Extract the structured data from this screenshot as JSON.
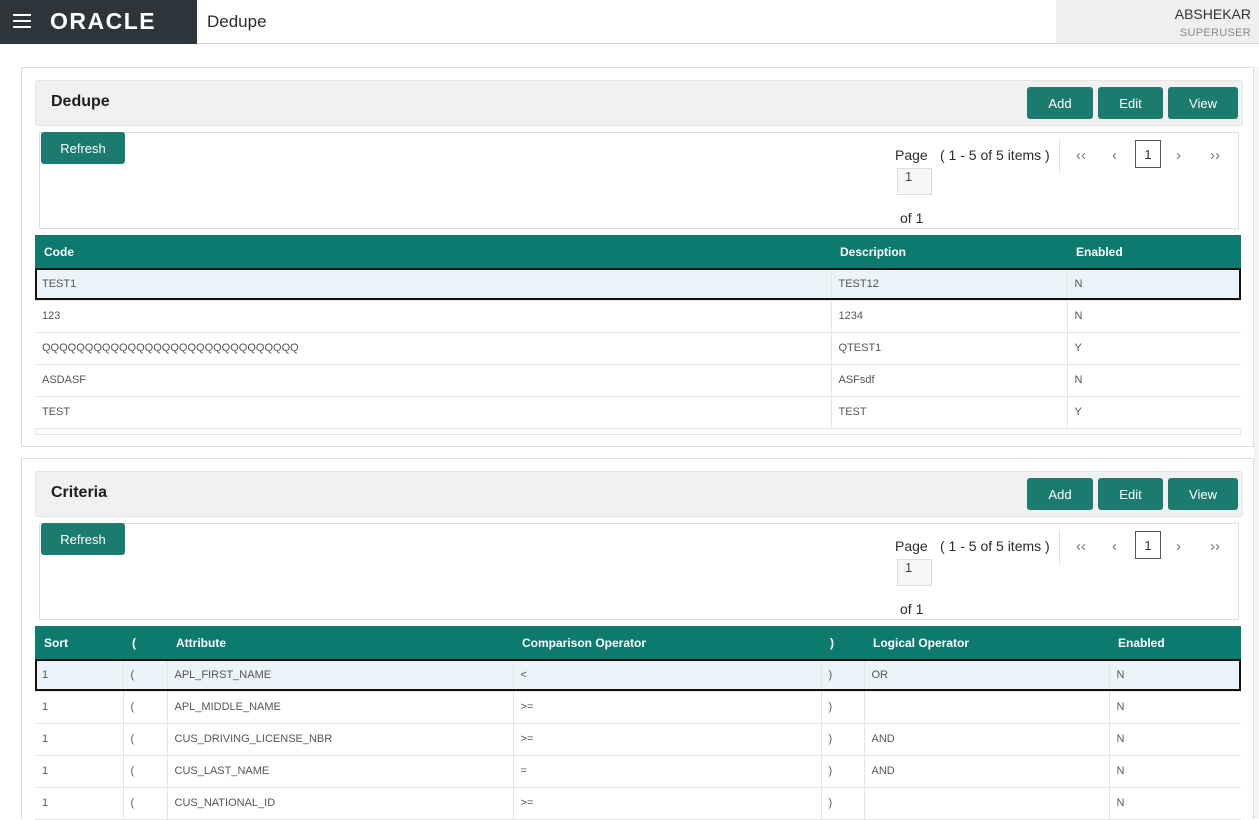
{
  "header": {
    "logo_text": "ORACLE",
    "app_title": "Dedupe",
    "user_name": "ABSHEKAR",
    "user_role": "SUPERUSER"
  },
  "dedupe": {
    "title": "Dedupe",
    "add_label": "Add",
    "edit_label": "Edit",
    "view_label": "View",
    "refresh_label": "Refresh",
    "pager": {
      "page_label": "Page",
      "range": "( 1 - 5 of 5 items )",
      "page_value": "1",
      "of_label": "of 1",
      "current_page": "1"
    },
    "columns": [
      "Code",
      "Description",
      "Enabled"
    ],
    "rows": [
      [
        "TEST1",
        "TEST12",
        "N"
      ],
      [
        "123",
        "1234",
        "N"
      ],
      [
        "QQQQQQQQQQQQQQQQQQQQQQQQQQQQQQ",
        "QTEST1",
        "Y"
      ],
      [
        "ASDASF",
        "ASFsdf",
        "N"
      ],
      [
        "TEST",
        "TEST",
        "Y"
      ]
    ]
  },
  "criteria": {
    "title": "Criteria",
    "add_label": "Add",
    "edit_label": "Edit",
    "view_label": "View",
    "refresh_label": "Refresh",
    "pager": {
      "page_label": "Page",
      "range": "( 1 - 5 of 5 items )",
      "page_value": "1",
      "of_label": "of 1",
      "current_page": "1"
    },
    "columns": [
      "Sort",
      "(",
      "Attribute",
      "Comparison Operator",
      ")",
      "Logical Operator",
      "Enabled"
    ],
    "rows": [
      [
        "1",
        "(",
        "APL_FIRST_NAME",
        "<",
        ")",
        "OR",
        "N"
      ],
      [
        "1",
        "(",
        "APL_MIDDLE_NAME",
        ">=",
        ")",
        "",
        "N"
      ],
      [
        "1",
        "(",
        "CUS_DRIVING_LICENSE_NBR",
        ">=",
        ")",
        "AND",
        "N"
      ],
      [
        "1",
        "(",
        "CUS_LAST_NAME",
        "=",
        ")",
        "AND",
        "N"
      ],
      [
        "1",
        "(",
        "CUS_NATIONAL_ID",
        ">=",
        ")",
        "",
        "N"
      ]
    ]
  },
  "icons": {
    "menu": "hamburger-menu-icon",
    "first": "first-page-icon",
    "prev": "previous-page-icon",
    "next": "next-page-icon",
    "last": "last-page-icon"
  },
  "colors": {
    "accent": "#1b7b6f",
    "table_header": "#0d7a6e",
    "brand_bg": "#2d353b",
    "selected_row": "#eaf4f9"
  }
}
